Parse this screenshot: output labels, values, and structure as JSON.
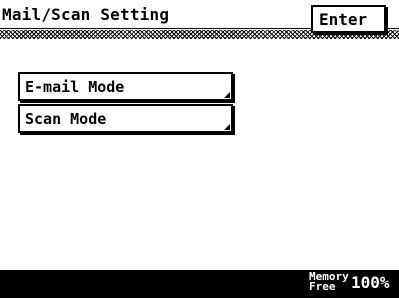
{
  "header": {
    "title": "Mail/Scan Setting",
    "enter_label": "Enter"
  },
  "menu": {
    "items": [
      {
        "label": "E-mail Mode"
      },
      {
        "label": "Scan Mode"
      }
    ]
  },
  "footer": {
    "memory_label_line1": "Memory",
    "memory_label_line2": "Free",
    "memory_value": "100%"
  },
  "colors": {
    "foreground": "#000000",
    "background": "#ffffff"
  }
}
